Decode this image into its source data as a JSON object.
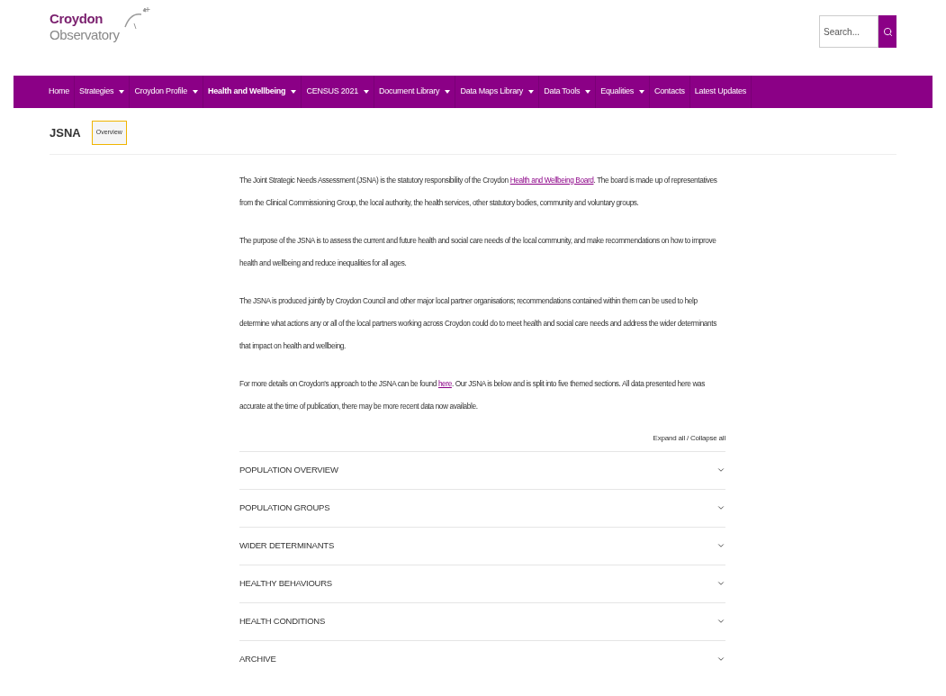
{
  "logo": {
    "line1": "Croydon",
    "line2": "Observatory"
  },
  "search": {
    "placeholder": "Search..."
  },
  "nav": [
    {
      "label": "Home",
      "dropdown": false,
      "selected": false
    },
    {
      "label": "Strategies",
      "dropdown": true,
      "selected": false
    },
    {
      "label": "Croydon Profile",
      "dropdown": true,
      "selected": false
    },
    {
      "label": "Health and Wellbeing",
      "dropdown": true,
      "selected": true
    },
    {
      "label": "CENSUS 2021",
      "dropdown": true,
      "selected": false
    },
    {
      "label": "Document Library",
      "dropdown": true,
      "selected": false
    },
    {
      "label": "Data Maps Library",
      "dropdown": true,
      "selected": false
    },
    {
      "label": "Data Tools",
      "dropdown": true,
      "selected": false
    },
    {
      "label": "Equalities",
      "dropdown": true,
      "selected": false
    },
    {
      "label": "Contacts",
      "dropdown": false,
      "selected": false
    },
    {
      "label": "Latest Updates",
      "dropdown": false,
      "selected": false
    }
  ],
  "page": {
    "title": "JSNA",
    "tabs": [
      {
        "label": "Overview",
        "selected": true
      }
    ]
  },
  "paragraphs": [
    [
      {
        "kind": "text",
        "text": "The Joint Strategic Needs Assessment (JSNA) is the statutory responsibility of the Croydon "
      },
      {
        "kind": "link",
        "text": "Health and Wellbeing Board"
      },
      {
        "kind": "text",
        "text": ". The board is made up of representatives from the Clinical Commissioning Group, the local authority, the health services, other statutory bodies, community and voluntary groups."
      }
    ],
    [
      {
        "kind": "text",
        "text": "The purpose of the JSNA is to assess the current and future health and social care needs of the local community, and make recommendations on how to improve health and wellbeing and reduce inequalities for all ages."
      }
    ],
    [
      {
        "kind": "text",
        "text": "The JSNA is produced jointly by Croydon Council and other major local partner organisations; recommendations contained within them can be used to help determine what actions any or all of the local partners working across Croydon could do to meet health and social care needs and address the wider determinants that impact on health and wellbeing."
      }
    ],
    [
      {
        "kind": "text",
        "text": "For more details on Croydon's approach to the JSNA can be found "
      },
      {
        "kind": "link",
        "text": "here"
      },
      {
        "kind": "text",
        "text": ". Our JSNA is below and is split into five themed sections. All data presented here was accurate at the time of publication, there may be more recent data now available."
      }
    ]
  ],
  "expand_all": "Expand all / Collapse all",
  "sections": [
    {
      "label": "POPULATION OVERVIEW",
      "expanded": false
    },
    {
      "label": "POPULATION GROUPS",
      "expanded": false
    },
    {
      "label": "WIDER DETERMINANTS",
      "expanded": false
    },
    {
      "label": "HEALTHY BEHAVIOURS",
      "expanded": false
    },
    {
      "label": "HEALTH CONDITIONS",
      "expanded": false
    },
    {
      "label": "ARCHIVE",
      "expanded": false
    }
  ]
}
